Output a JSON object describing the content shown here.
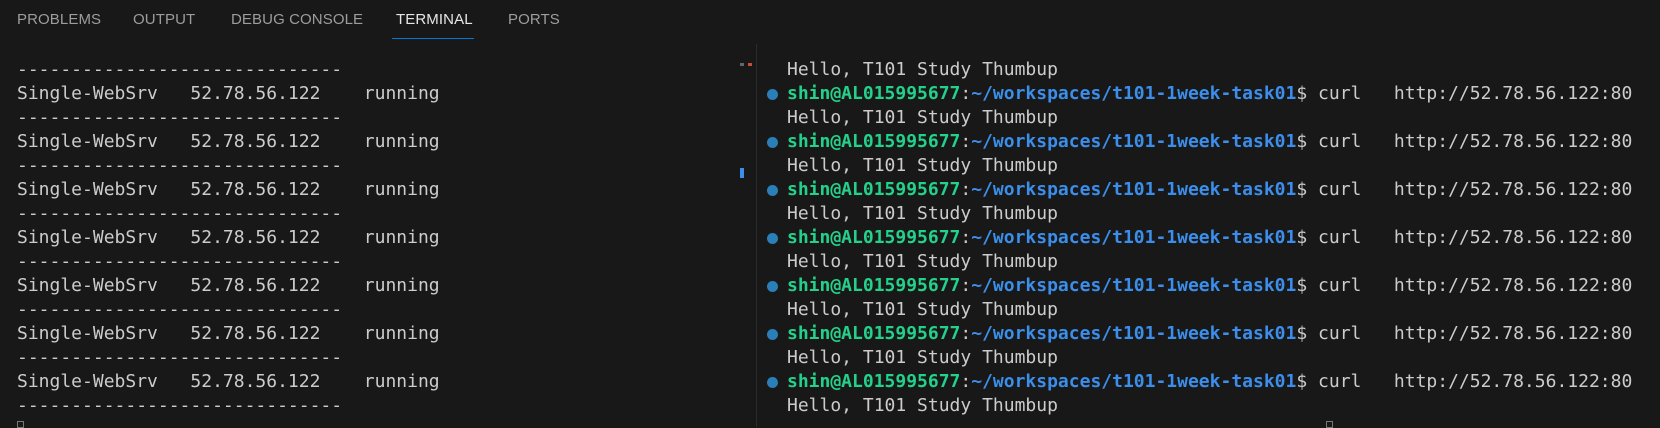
{
  "tabs": [
    "PROBLEMS",
    "OUTPUT",
    "DEBUG CONSOLE",
    "TERMINAL",
    "PORTS"
  ],
  "active_tab": "TERMINAL",
  "left_terminal": {
    "separator": "------------------------------",
    "rows": [
      "Single-WebSrv   52.78.56.122    running",
      "Single-WebSrv   52.78.56.122    running",
      "Single-WebSrv   52.78.56.122    running",
      "Single-WebSrv   52.78.56.122    running",
      "Single-WebSrv   52.78.56.122    running",
      "Single-WebSrv   52.78.56.122    running",
      "Single-WebSrv   52.78.56.122    running"
    ]
  },
  "right_terminal": {
    "output": "Hello, T101 Study Thumbup",
    "user_host": "shin@AL015995677",
    "colon": ":",
    "path": "~/workspaces/t101-1week-task01",
    "prompt_end": "$ ",
    "command": "curl   http://52.78.56.122:80",
    "prompt_count": 7
  },
  "colors": {
    "user": "#23d18b",
    "path": "#3b8eea",
    "active_tab_underline": "#0078d4",
    "status_dot": "#2a7fb8"
  }
}
